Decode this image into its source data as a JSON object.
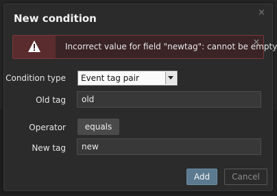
{
  "dialog": {
    "title": "New condition",
    "close_symbol": "×"
  },
  "alert": {
    "icon": "warning-triangle-icon",
    "message": "Incorrect value for field \"newtag\": cannot be empty.",
    "close_symbol": "×",
    "colors": {
      "background": "#3a2426",
      "border": "#7a3a3c",
      "icon_box": "#5a2c2e"
    }
  },
  "form": {
    "condition_type": {
      "label": "Condition type",
      "value": "Event tag pair"
    },
    "old_tag": {
      "label": "Old tag",
      "value": "old"
    },
    "operator": {
      "label": "Operator",
      "value": "equals"
    },
    "new_tag": {
      "label": "New tag",
      "value": "new"
    }
  },
  "buttons": {
    "add": "Add",
    "cancel": "Cancel"
  },
  "colors": {
    "accent": "#5b7a90",
    "dialog_bg": "#2b2b2b"
  }
}
